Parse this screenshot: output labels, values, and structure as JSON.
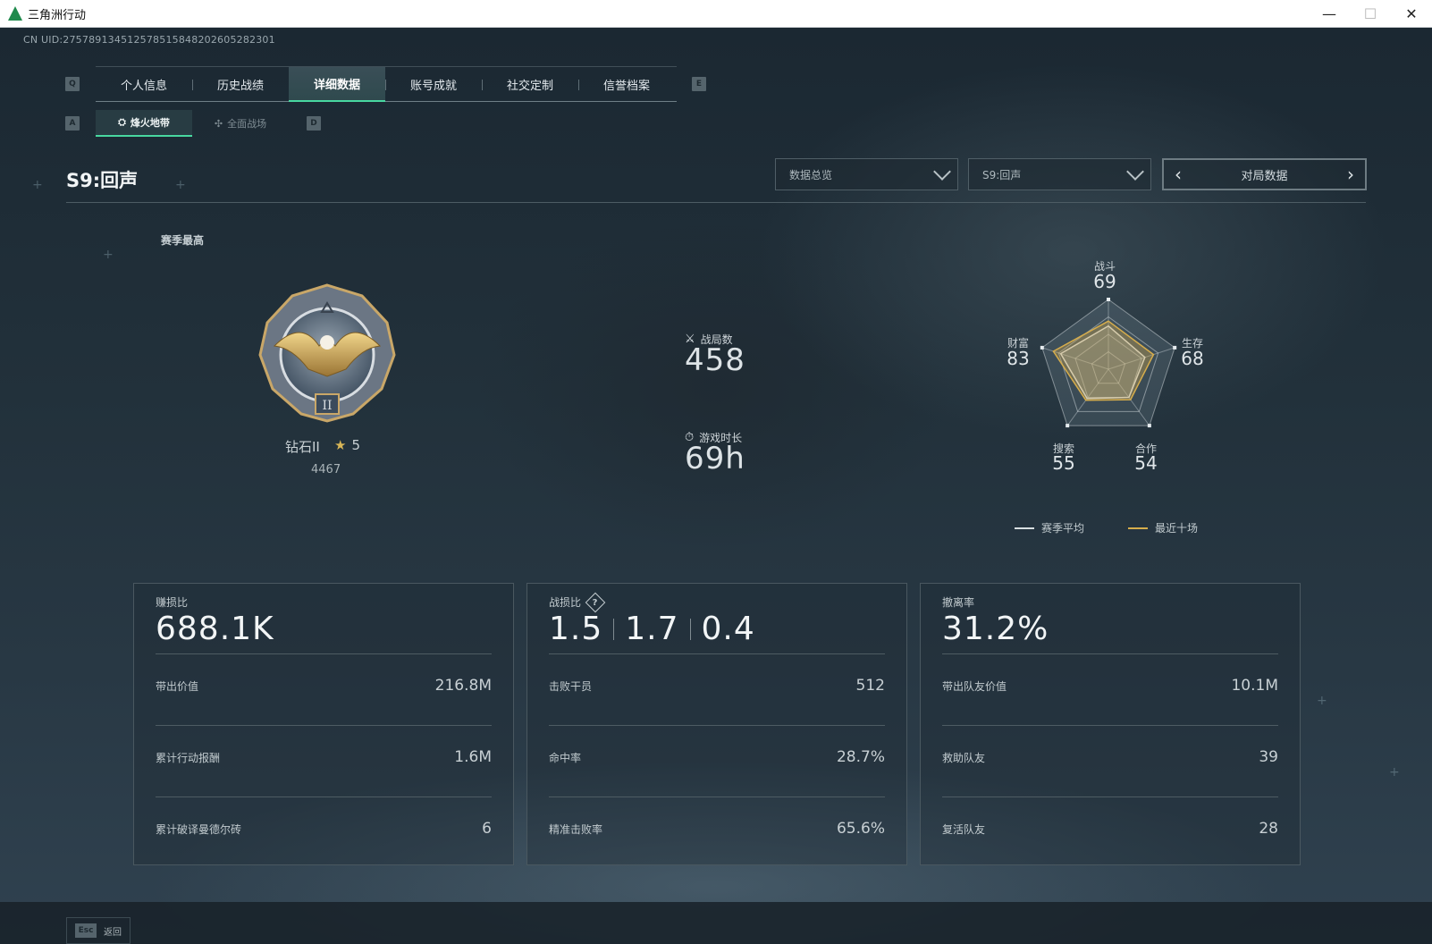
{
  "window": {
    "title": "三角洲行动",
    "minimize": "—",
    "maximize": "☐",
    "close": "✕"
  },
  "uid": "CN UID:275789134512578515848202605282301",
  "tabs": [
    {
      "label": "个人信息",
      "active": false
    },
    {
      "label": "历史战绩",
      "active": false
    },
    {
      "label": "详细数据",
      "active": true
    },
    {
      "label": "账号成就",
      "active": false
    },
    {
      "label": "社交定制",
      "active": false
    },
    {
      "label": "信誉档案",
      "active": false
    }
  ],
  "keys": {
    "prev_tab": "Q",
    "next_tab": "E",
    "prev_sub": "A",
    "next_sub": "D"
  },
  "subtabs": [
    {
      "label": "烽火地带",
      "active": true
    },
    {
      "label": "全面战场",
      "active": false
    }
  ],
  "season": {
    "title": "S9:回声",
    "dropdown_view": "数据总览",
    "dropdown_season": "S9:回声",
    "pager_label": "对局数据"
  },
  "rank": {
    "heading": "赛季最高",
    "name": "钻石II",
    "stars": "5",
    "score": "4467"
  },
  "summary": {
    "matches_label": "战局数",
    "matches_value": "458",
    "playtime_label": "游戏时长",
    "playtime_value": "69h"
  },
  "radar": {
    "axes": [
      {
        "label": "战斗",
        "value": "69"
      },
      {
        "label": "生存",
        "value": "68"
      },
      {
        "label": "合作",
        "value": "54"
      },
      {
        "label": "搜索",
        "value": "55"
      },
      {
        "label": "财富",
        "value": "83"
      }
    ],
    "season_avg": [
      0.62,
      0.55,
      0.5,
      0.52,
      0.72
    ],
    "recent": [
      0.69,
      0.68,
      0.54,
      0.55,
      0.83
    ],
    "legend_avg": "赛季平均",
    "legend_recent": "最近十场",
    "colors": {
      "avg": "#d8dee1",
      "recent": "#d6ad4c"
    }
  },
  "cards": [
    {
      "head_label": "赚损比",
      "big": [
        "688.1K"
      ],
      "rows": [
        {
          "label": "带出价值",
          "value": "216.8M"
        },
        {
          "label": "累计行动报酬",
          "value": "1.6M"
        },
        {
          "label": "累计破译曼德尔砖",
          "value": "6"
        }
      ]
    },
    {
      "head_label": "战损比",
      "has_help": true,
      "big": [
        "1.5",
        "1.7",
        "0.4"
      ],
      "rows": [
        {
          "label": "击败干员",
          "value": "512"
        },
        {
          "label": "命中率",
          "value": "28.7%"
        },
        {
          "label": "精准击败率",
          "value": "65.6%"
        }
      ]
    },
    {
      "head_label": "撤离率",
      "big": [
        "31.2%"
      ],
      "rows": [
        {
          "label": "带出队友价值",
          "value": "10.1M"
        },
        {
          "label": "救助队友",
          "value": "39"
        },
        {
          "label": "复活队友",
          "value": "28"
        }
      ]
    }
  ],
  "help_mark": "?",
  "footer": {
    "esc_key": "Esc",
    "back_label": "返回"
  },
  "accent": "#48d8a0"
}
